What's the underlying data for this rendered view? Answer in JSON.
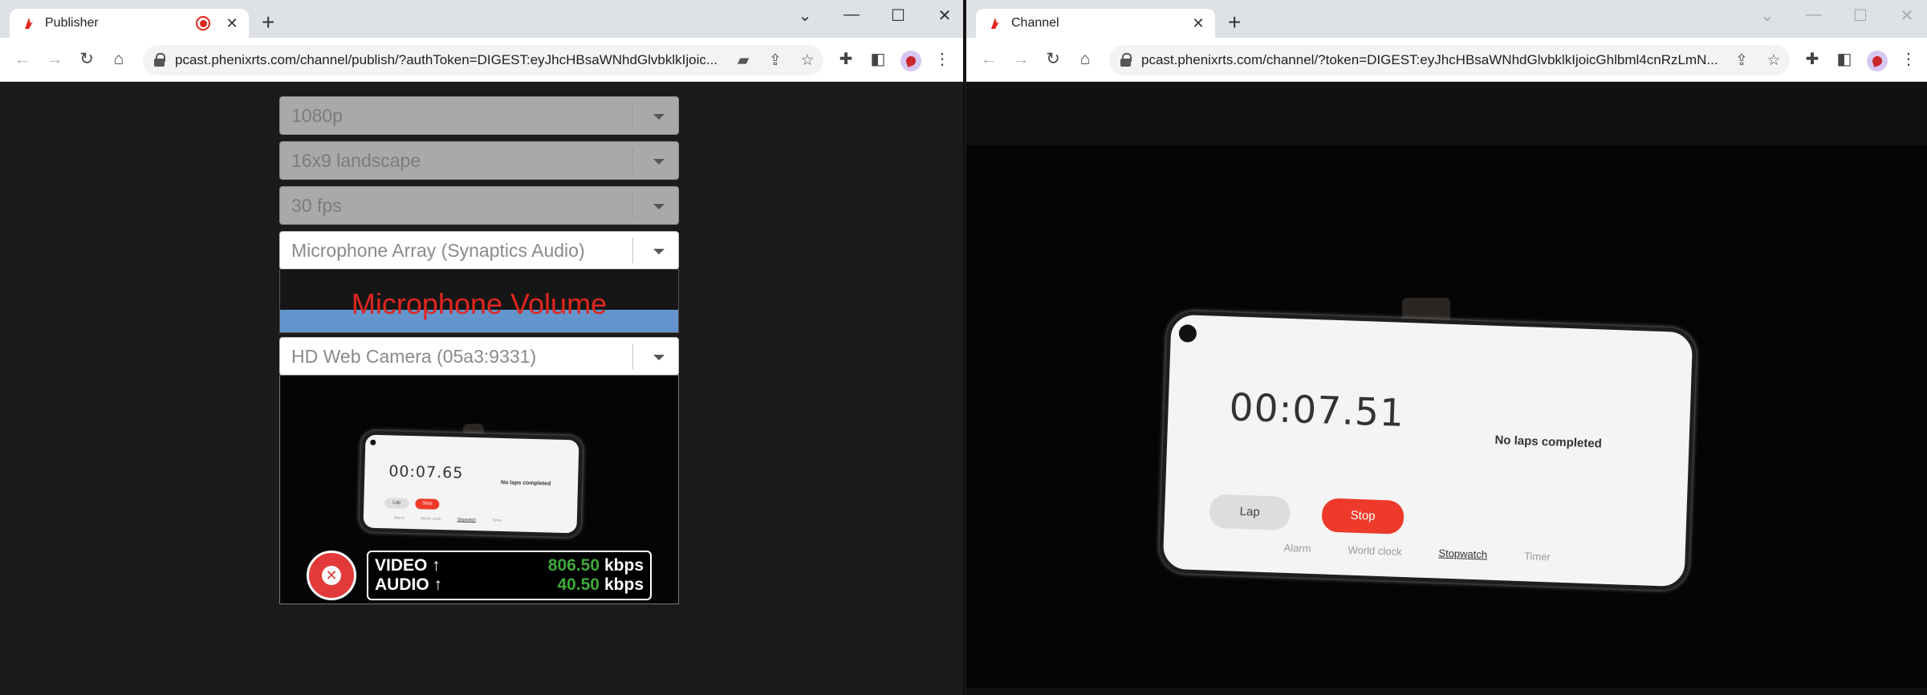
{
  "left_window": {
    "tab_title": "Publisher",
    "url": "pcast.phenixrts.com/channel/publish/?authToken=DIGEST:eyJhcHBsaWNhdGlvbklkIjoic...",
    "resolution_select": "1080p",
    "aspect_select": "16x9 landscape",
    "fps_select": "30 fps",
    "microphone_select": "Microphone Array (Synaptics Audio)",
    "microphone_volume_label": "Microphone Volume",
    "camera_select": "HD Web Camera (05a3:9331)",
    "preview": {
      "stopwatch_time": "00:07.65",
      "no_laps": "No laps completed",
      "lap_label": "Lap",
      "stop_label": "Stop",
      "tabs": [
        "Alarm",
        "World clock",
        "Stopwatch",
        "Timer"
      ]
    },
    "stats": {
      "video_label": "VIDEO ↑",
      "video_value": "806.50",
      "video_unit": "kbps",
      "audio_label": "AUDIO ↑",
      "audio_value": "40.50",
      "audio_unit": "kbps"
    }
  },
  "right_window": {
    "tab_title": "Channel",
    "url": "pcast.phenixrts.com/channel/?token=DIGEST:eyJhcHBsaWNhdGlvbklkIjoicGhlbml4cnRzLmN...",
    "stream": {
      "stopwatch_time": "00:07.51",
      "no_laps": "No laps completed",
      "lap_label": "Lap",
      "stop_label": "Stop",
      "tabs": [
        "Alarm",
        "World clock",
        "Stopwatch",
        "Timer"
      ]
    }
  },
  "icons": {
    "favicon": "phenix-logo-icon",
    "recording": "recording-icon",
    "camera_in_omnibox": "camera-icon",
    "share": "share-icon",
    "bookmark": "star-icon",
    "extensions": "puzzle-icon",
    "side_panel": "side-panel-icon",
    "profile": "avatar",
    "menu": "kebab-menu-icon",
    "stop_publish": "stop-x-icon"
  },
  "colors": {
    "accent_red": "#e0261f",
    "volume_bar": "#6494cc",
    "bitrate_green": "#3fa93a"
  }
}
